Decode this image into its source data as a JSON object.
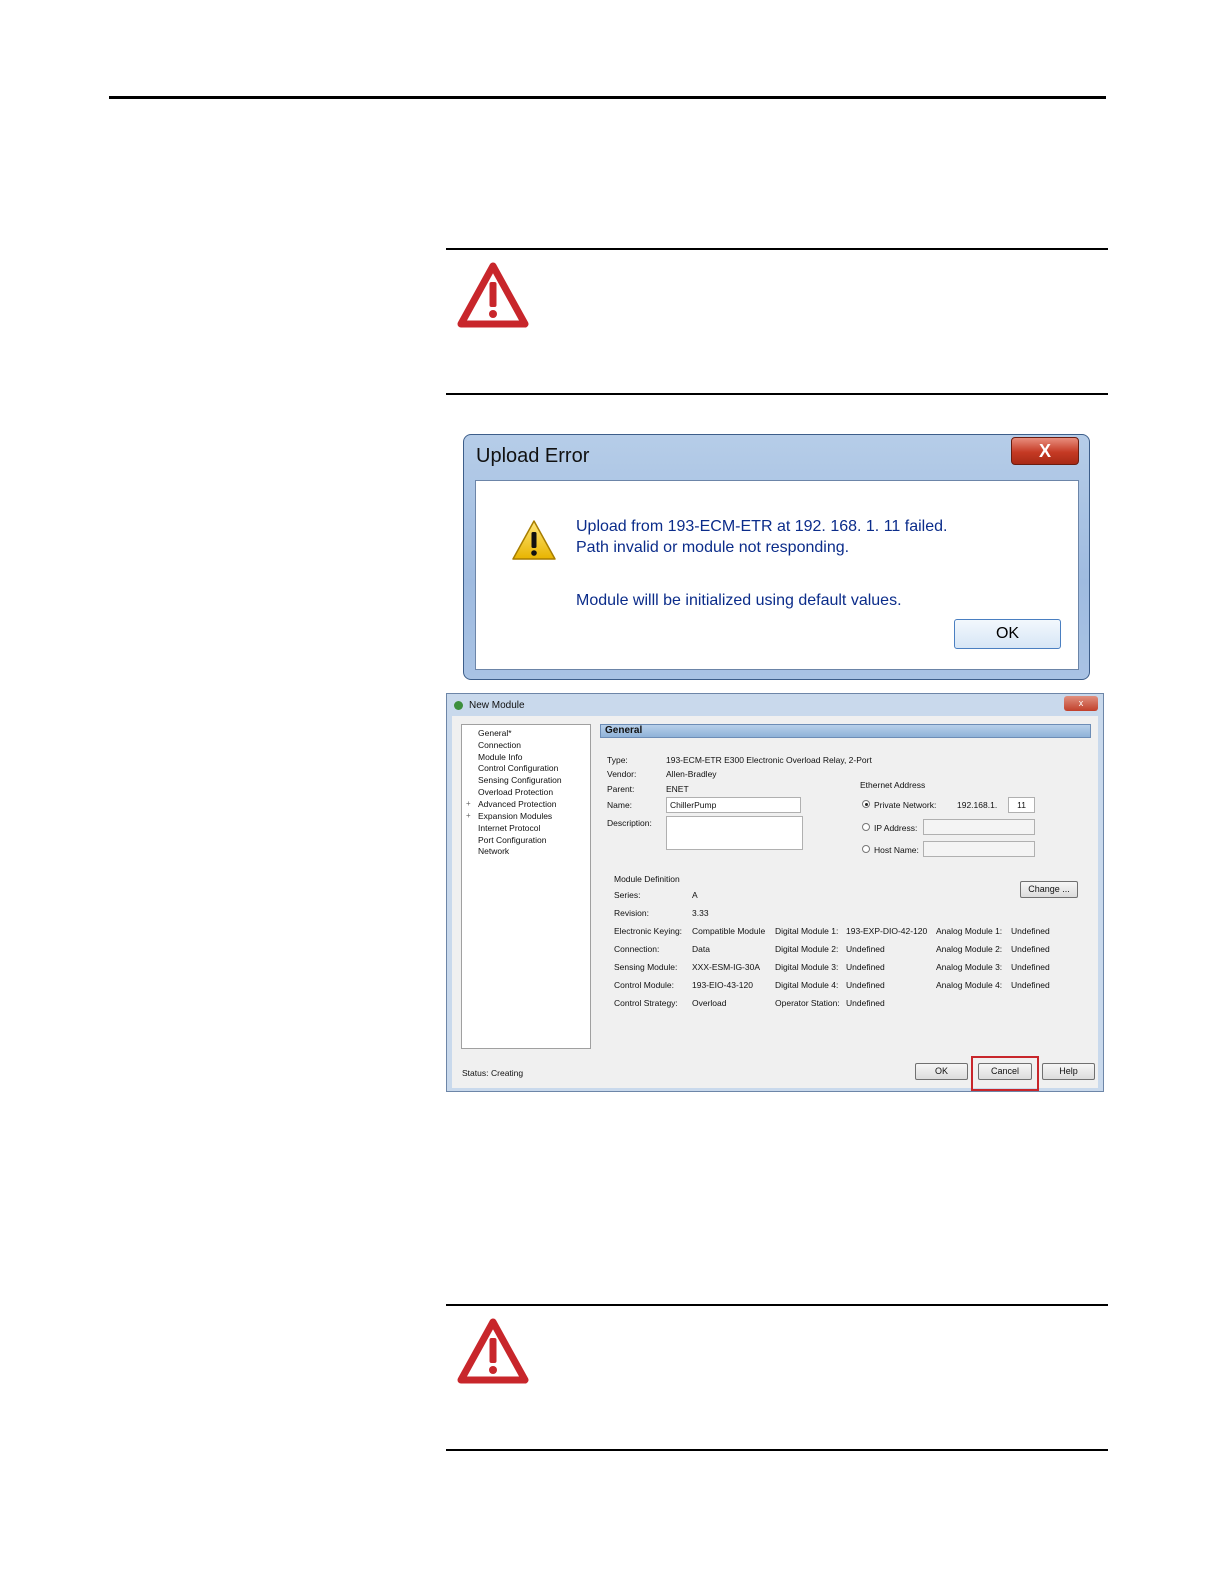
{
  "upload_error": {
    "title": "Upload Error",
    "close_label": "X",
    "line1": "Upload from 193-ECM-ETR at 192. 168. 1. 11 failed.",
    "line2": "Path invalid or module not responding.",
    "line3": "Module willl be initialized using default values.",
    "ok_label": "OK"
  },
  "new_module": {
    "title": "New Module",
    "close_label": "x",
    "tree": [
      "General*",
      "Connection",
      "Module Info",
      "Control Configuration",
      "Sensing Configuration",
      "Overload Protection",
      "Advanced Protection",
      "Expansion Modules",
      "Internet Protocol",
      "Port Configuration",
      "Network"
    ],
    "section_title": "General",
    "type_label": "Type:",
    "type_value": "193-ECM-ETR E300 Electronic Overload Relay, 2-Port",
    "vendor_label": "Vendor:",
    "vendor_value": "Allen-Bradley",
    "parent_label": "Parent:",
    "parent_value": "ENET",
    "name_label": "Name:",
    "name_value": "ChillerPump",
    "description_label": "Description:",
    "ethernet_label": "Ethernet Address",
    "private_network_label": "Private Network:",
    "private_network_prefix": "192.168.1.",
    "private_network_host": "11",
    "ip_address_label": "IP Address:",
    "host_name_label": "Host Name:",
    "module_definition_label": "Module Definition",
    "series_label": "Series:",
    "series_value": "A",
    "revision_label": "Revision:",
    "revision_value": "3.33",
    "change_label": "Change ...",
    "definition_rows": [
      {
        "l1": "Electronic Keying:",
        "v1": "Compatible Module",
        "l2": "Digital Module 1:",
        "v2": "193-EXP-DIO-42-120",
        "l3": "Analog Module 1:",
        "v3": "Undefined"
      },
      {
        "l1": "Connection:",
        "v1": "Data",
        "l2": "Digital Module 2:",
        "v2": "Undefined",
        "l3": "Analog Module 2:",
        "v3": "Undefined"
      },
      {
        "l1": "Sensing Module:",
        "v1": "XXX-ESM-IG-30A",
        "l2": "Digital Module 3:",
        "v2": "Undefined",
        "l3": "Analog Module 3:",
        "v3": "Undefined"
      },
      {
        "l1": "Control Module:",
        "v1": "193-EIO-43-120",
        "l2": "Digital Module 4:",
        "v2": "Undefined",
        "l3": "Analog Module 4:",
        "v3": "Undefined"
      },
      {
        "l1": "Control Strategy:",
        "v1": "Overload",
        "l2": "Operator Station:",
        "v2": "Undefined",
        "l3": "",
        "v3": ""
      }
    ],
    "status_label": "Status:",
    "status_value": "Creating",
    "ok_label": "OK",
    "cancel_label": "Cancel",
    "help_label": "Help"
  },
  "colors": {
    "warning_red": "#c8262b",
    "dialog_blue": "#a9c3e4",
    "message_blue": "#0b2c8a"
  }
}
